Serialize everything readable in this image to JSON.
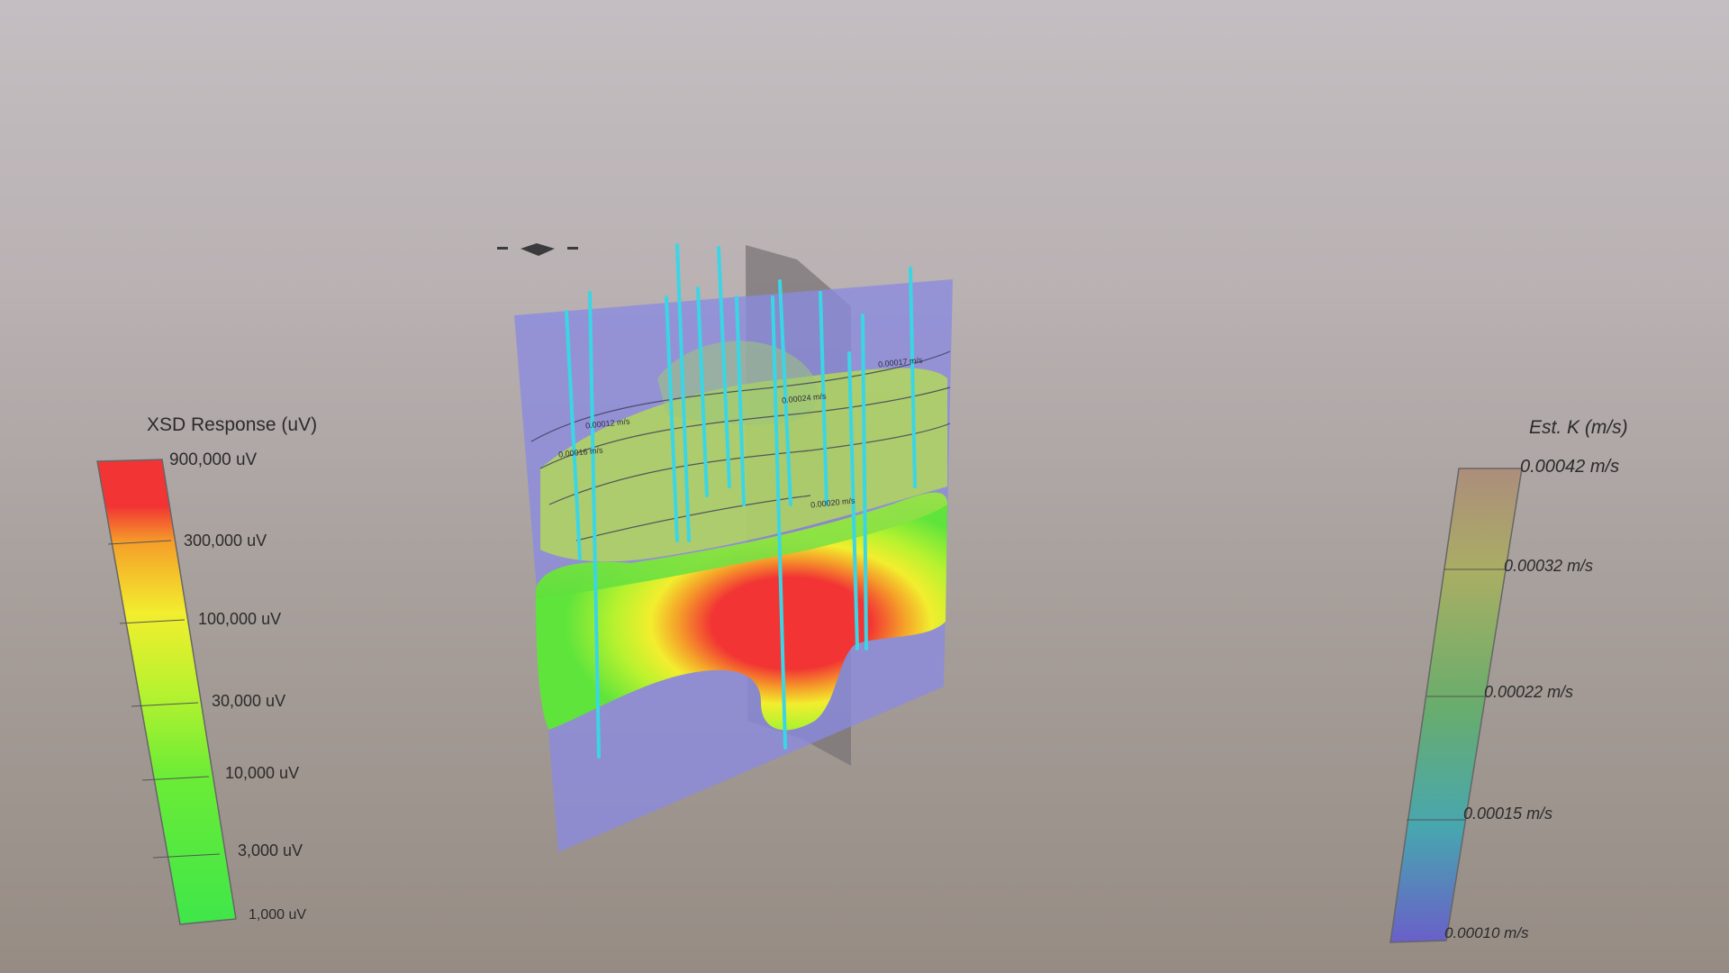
{
  "legend_left": {
    "title": "XSD Response (uV)",
    "ticks": [
      "900,000 uV",
      "300,000 uV",
      "100,000 uV",
      "30,000 uV",
      "10,000 uV",
      "3,000 uV",
      "1,000 uV"
    ],
    "colors": [
      "#f23434",
      "#f5a029",
      "#f2ee2e",
      "#b7f22f",
      "#6cec36",
      "#4ee641",
      "#3fe64a"
    ]
  },
  "legend_right": {
    "title": "Est. K (m/s)",
    "ticks": [
      "0.00042 m/s",
      "0.00032 m/s",
      "0.00022 m/s",
      "0.00015 m/s",
      "0.00010 m/s"
    ],
    "colors": [
      "#ad8d7c",
      "#a9ae63",
      "#69ad6c",
      "#47a6b0",
      "#6a5fc9"
    ]
  },
  "contour_labels": [
    "0.00012 m/s",
    "0.00016 m/s",
    "0.00017 m/s",
    "0.00024 m/s",
    "0.00020 m/s"
  ],
  "colors": {
    "plume_core": "#f23434",
    "plume_body": "#7be83a",
    "plane": "#8a8ae0",
    "wells": "#3ad6e6"
  }
}
